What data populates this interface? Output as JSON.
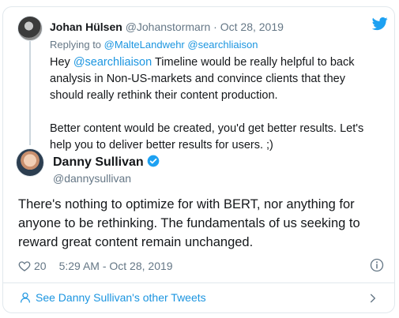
{
  "parent_tweet": {
    "author_name": "Johan Hülsen",
    "author_handle": "@Johanstormarn",
    "separator": "·",
    "date": "Oct 28, 2019",
    "replying_prefix": "Replying to",
    "replying_users": "@MalteLandwehr @searchliaison",
    "text_para1_prefix": "Hey ",
    "text_para1_mention": "@searchliaison",
    "text_para1_rest": " Timeline would be really helpful to back analysis in Non-US-markets and convince clients that they should really rethink their content production.",
    "text_para2": "Better content would be created, you'd get better results. Let's help you to deliver better results for users. ;)"
  },
  "main_tweet": {
    "author_name": "Danny Sullivan",
    "author_handle": "@dannysullivan",
    "text": "There's nothing to optimize for with BERT, nor anything for anyone to be rethinking. The fundamentals of us seeking to reward great content remain unchanged.",
    "like_count": "20",
    "timestamp": "5:29 AM - Oct 28, 2019"
  },
  "footer": {
    "more_tweets_label": "See Danny Sullivan's other Tweets"
  },
  "icons": {
    "twitter": "twitter-bird-icon",
    "verified": "verified-badge-icon",
    "like": "heart-icon",
    "info": "info-icon",
    "person": "person-icon",
    "chevron": "chevron-right-icon"
  },
  "colors": {
    "link": "#1b95e0",
    "muted": "#657786",
    "text": "#14171a",
    "border": "#e1e8ed"
  }
}
